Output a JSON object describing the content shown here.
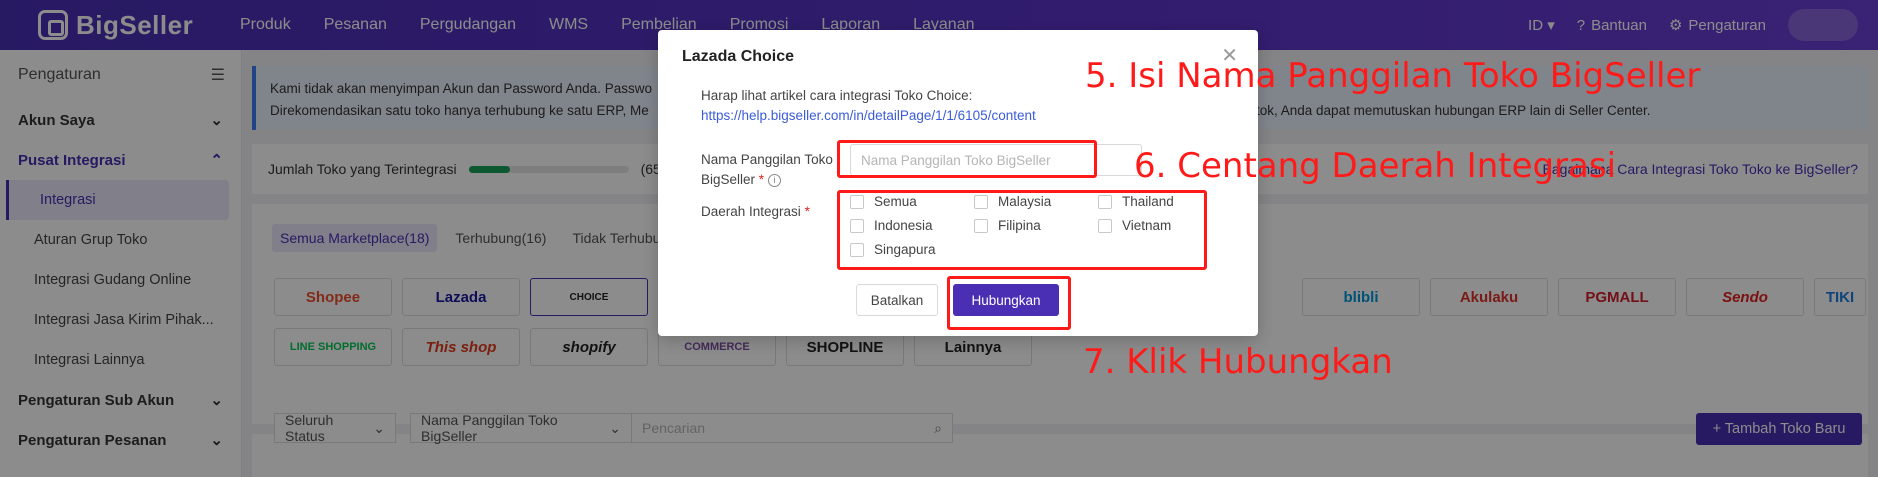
{
  "topbar": {
    "brand": "BigSeller",
    "nav": [
      "Produk",
      "Pesanan",
      "Pergudangan",
      "WMS",
      "Pembelian",
      "Promosi",
      "Laporan",
      "Layanan"
    ],
    "lang": "ID",
    "help": "Bantuan",
    "settings": "Pengaturan"
  },
  "sidebar": {
    "title": "Pengaturan",
    "sections": [
      {
        "label": "Akun Saya"
      },
      {
        "label": "Pusat Integrasi"
      }
    ],
    "items": [
      "Integrasi",
      "Aturan Grup Toko",
      "Integrasi Gudang Online",
      "Integrasi Jasa Kirim Pihak...",
      "Integrasi Lainnya"
    ],
    "more_sections": [
      "Pengaturan Sub Akun",
      "Pengaturan Pesanan"
    ]
  },
  "main": {
    "notice_line1": "Kami tidak akan menyimpan Akun dan Password Anda. Passwo",
    "notice_line2": "Direkomendasikan satu toko hanya terhubung ke satu ERP, Me",
    "notice_line2_right": "tok, Anda dapat memutuskan hubungan ERP lain di Seller Center.",
    "count_label": "Jumlah Toko yang Terintegrasi",
    "count_value": "(65/20",
    "count_progress": 0.26,
    "help_link": "Bagaimana Cara Integrasi Toko Toko ke BigSeller?",
    "tabs": [
      "Semua Marketplace(18)",
      "Terhubung(16)",
      "Tidak Terhubu"
    ],
    "marketplaces_row1": [
      "Shopee",
      "Lazada",
      "CHOICE",
      "blibli",
      "Akulaku",
      "PGMALL",
      "Sendo",
      "TIKI"
    ],
    "marketplaces_row2": [
      "LINE SHOPPING",
      "This shop",
      "shopify",
      "COMMERCE",
      "SHOPLINE",
      "Lainnya"
    ],
    "status_select": "Seluruh Status",
    "name_select": "Nama Panggilan Toko BigSeller",
    "search_placeholder": "Pencarian",
    "add_button": "+ Tambah Toko Baru"
  },
  "modal": {
    "title": "Lazada Choice",
    "info_text": "Harap lihat artikel cara integrasi Toko Choice:",
    "info_link": "https://help.bigseller.com/in/detailPage/1/1/6105/content",
    "name_label_1": "Nama Panggilan Toko",
    "name_label_2": "BigSeller",
    "name_placeholder": "Nama Panggilan Toko BigSeller",
    "region_label": "Daerah Integrasi",
    "regions": [
      "Semua",
      "Malaysia",
      "Thailand",
      "Indonesia",
      "Filipina",
      "Vietnam",
      "Singapura"
    ],
    "cancel": "Batalkan",
    "connect": "Hubungkan"
  },
  "annotations": {
    "step5": "5. Isi Nama Panggilan Toko BigSeller",
    "step6": "6. Centang Daerah Integrasi",
    "step7": "7. Klik Hubungkan"
  },
  "colors": {
    "brand": "#4a2fb5",
    "annotation": "#ff1a1a"
  }
}
